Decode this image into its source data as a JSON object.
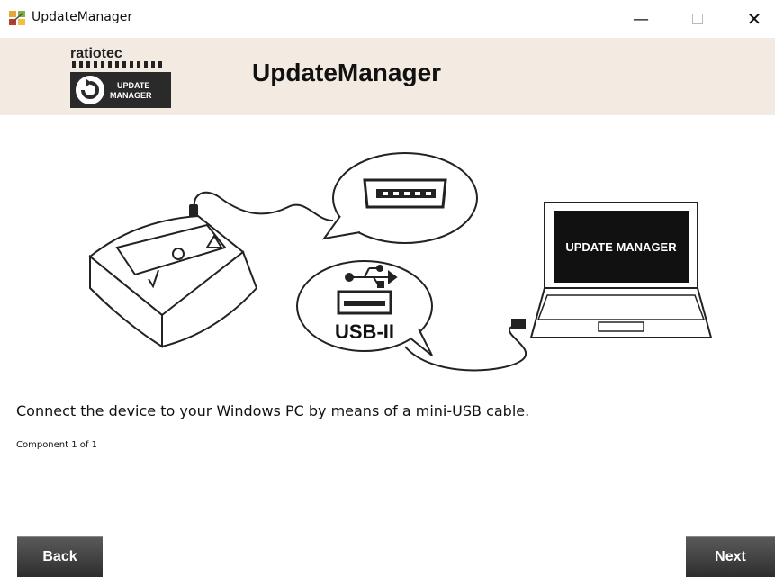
{
  "window": {
    "title": "UpdateManager",
    "controls": {
      "minimize": "—",
      "maximize": "☐",
      "close": "✕"
    }
  },
  "header": {
    "logo_brand": "ratiotec",
    "logo_caption_line1": "UPDATE",
    "logo_caption_line2": "MANAGER",
    "heading": "UpdateManager"
  },
  "illustration": {
    "laptop_screen_text": "UPDATE MANAGER",
    "usb_label": "USB-II",
    "icons": [
      "device-icon",
      "mini-usb-port-icon",
      "usb-port-icon",
      "laptop-icon",
      "cable-icon"
    ]
  },
  "main": {
    "instruction": "Connect the device to your Windows PC by means of a mini-USB cable.",
    "component_status": "Component 1 of 1"
  },
  "footer": {
    "back_label": "Back",
    "next_label": "Next"
  },
  "colors": {
    "header_bg": "#f3ebe1",
    "button_bg": "#3a3a3a",
    "button_text": "#ffffff"
  }
}
